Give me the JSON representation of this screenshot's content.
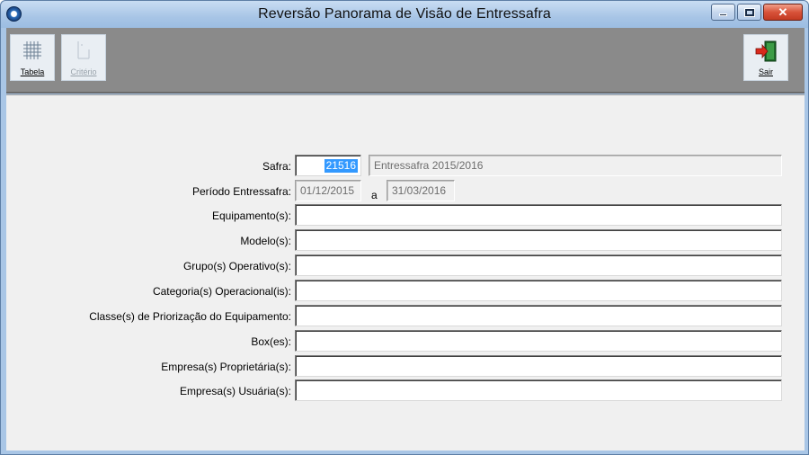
{
  "window": {
    "title": "Reversão Panorama de Visão de Entressafra"
  },
  "toolbar": {
    "tabela_label": "Tabela",
    "criterio_label": "Critério",
    "sair_label": "Sair"
  },
  "form": {
    "safra": {
      "label": "Safra:",
      "value": "21516",
      "description": "Entressafra 2015/2016"
    },
    "periodo": {
      "label": "Período Entressafra:",
      "start": "01/12/2015",
      "separator": "a",
      "end": "31/03/2016"
    },
    "equipamentos": {
      "label": "Equipamento(s):",
      "value": ""
    },
    "modelos": {
      "label": "Modelo(s):",
      "value": ""
    },
    "grupos": {
      "label": "Grupo(s) Operativo(s):",
      "value": ""
    },
    "categorias": {
      "label": "Categoria(s) Operacional(is):",
      "value": ""
    },
    "classes": {
      "label": "Classe(s) de Priorização do Equipamento:",
      "value": ""
    },
    "boxes": {
      "label": "Box(es):",
      "value": ""
    },
    "proprietarias": {
      "label": "Empresa(s) Proprietária(s):",
      "value": ""
    },
    "usuarias": {
      "label": "Empresa(s) Usuária(s):",
      "value": ""
    }
  },
  "icons": {
    "app": "app-icon",
    "tabela": "table-grid-icon",
    "criterio": "criteria-icon",
    "sair": "exit-door-icon"
  }
}
